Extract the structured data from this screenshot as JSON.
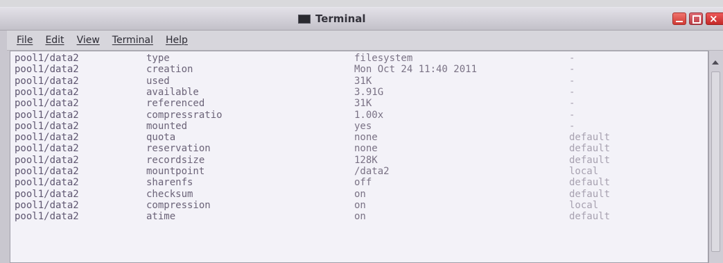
{
  "window": {
    "title": "Terminal"
  },
  "menu": [
    "File",
    "Edit",
    "View",
    "Terminal",
    "Help"
  ],
  "icons": {
    "app": "terminal-icon",
    "minimize": "minimize-icon",
    "maximize": "maximize-icon",
    "close": "close-icon",
    "scroll_up": "scroll-up-arrow-icon"
  },
  "terminal": {
    "rows": [
      {
        "name": "pool1/data2",
        "property": "type",
        "value": "filesystem",
        "source": "-"
      },
      {
        "name": "pool1/data2",
        "property": "creation",
        "value": "Mon Oct 24 11:40 2011",
        "source": "-"
      },
      {
        "name": "pool1/data2",
        "property": "used",
        "value": "31K",
        "source": "-"
      },
      {
        "name": "pool1/data2",
        "property": "available",
        "value": "3.91G",
        "source": "-"
      },
      {
        "name": "pool1/data2",
        "property": "referenced",
        "value": "31K",
        "source": "-"
      },
      {
        "name": "pool1/data2",
        "property": "compressratio",
        "value": "1.00x",
        "source": "-"
      },
      {
        "name": "pool1/data2",
        "property": "mounted",
        "value": "yes",
        "source": "-"
      },
      {
        "name": "pool1/data2",
        "property": "quota",
        "value": "none",
        "source": "default"
      },
      {
        "name": "pool1/data2",
        "property": "reservation",
        "value": "none",
        "source": "default"
      },
      {
        "name": "pool1/data2",
        "property": "recordsize",
        "value": "128K",
        "source": "default"
      },
      {
        "name": "pool1/data2",
        "property": "mountpoint",
        "value": "/data2",
        "source": "local"
      },
      {
        "name": "pool1/data2",
        "property": "sharenfs",
        "value": "off",
        "source": "default"
      },
      {
        "name": "pool1/data2",
        "property": "checksum",
        "value": "on",
        "source": "default"
      },
      {
        "name": "pool1/data2",
        "property": "compression",
        "value": "on",
        "source": "local"
      },
      {
        "name": "pool1/data2",
        "property": "atime",
        "value": "on",
        "source": "default"
      }
    ]
  }
}
